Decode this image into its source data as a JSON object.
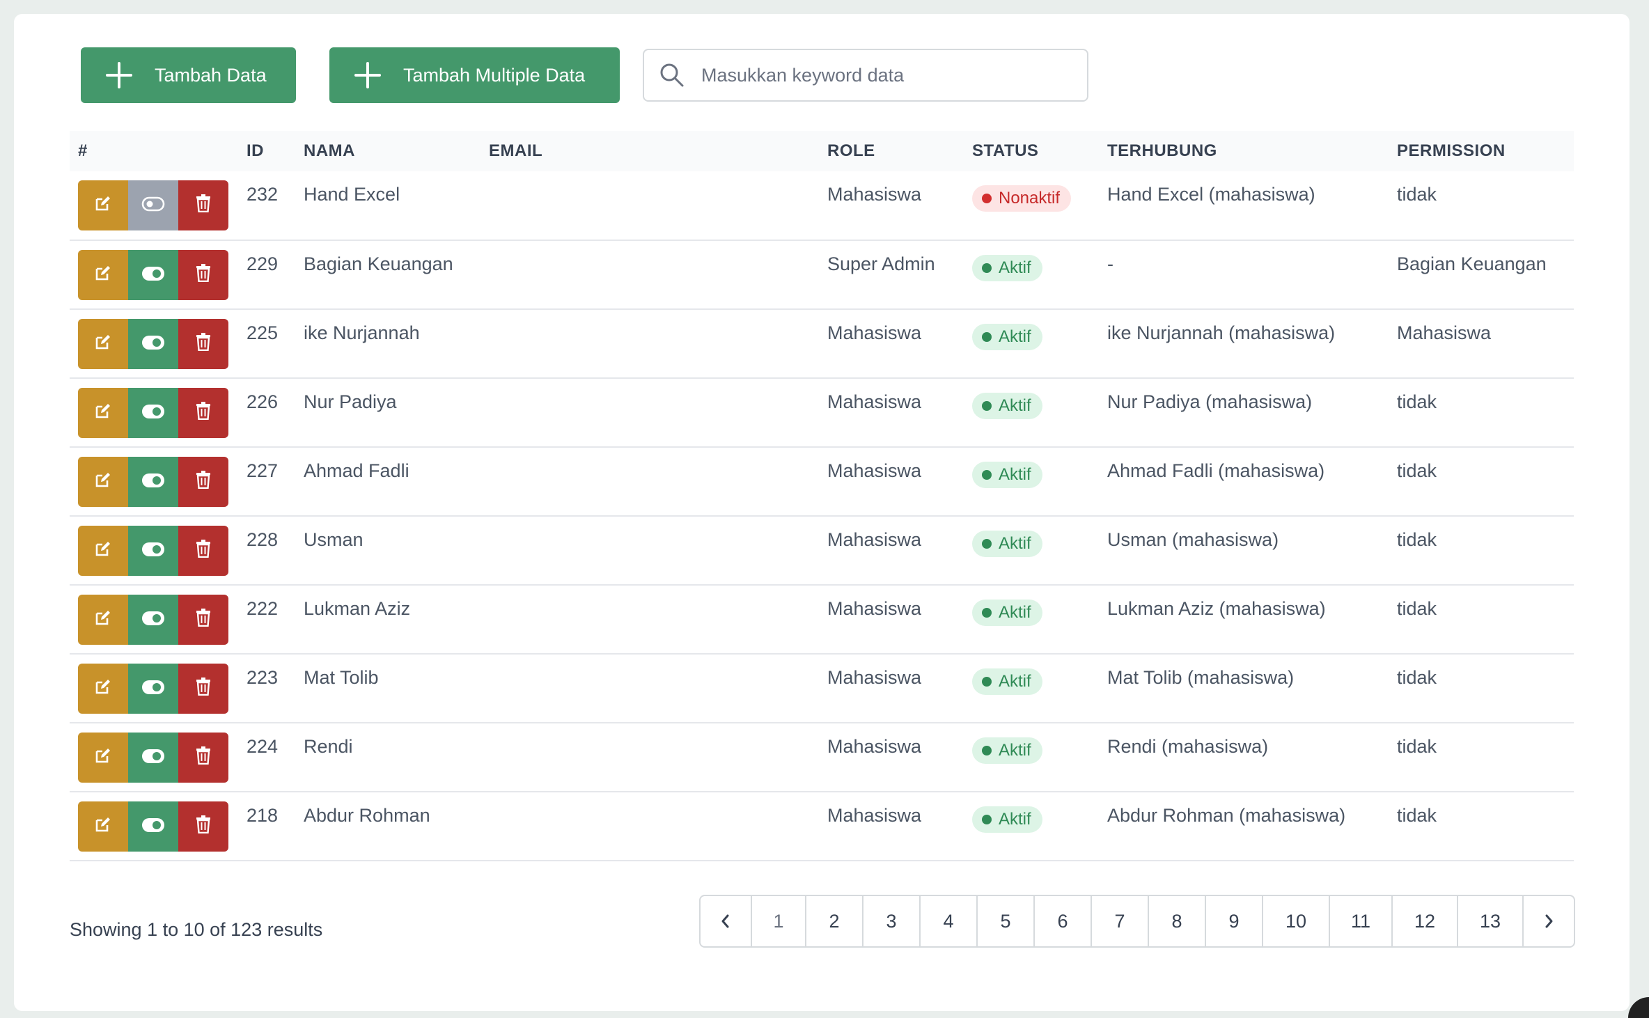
{
  "toolbar": {
    "add_label": "Tambah Data",
    "add_multiple_label": "Tambah Multiple Data",
    "search_placeholder": "Masukkan keyword data",
    "search_value": ""
  },
  "table": {
    "headers": [
      "#",
      "ID",
      "NAMA",
      "EMAIL",
      "ROLE",
      "STATUS",
      "TERHUBUNG",
      "PERMISSION"
    ],
    "rows": [
      {
        "id": "232",
        "nama": "Hand Excel",
        "email": "",
        "role": "Mahasiswa",
        "status": "Nonaktif",
        "active": false,
        "terhubung": "Hand Excel (mahasiswa)",
        "permission": "tidak"
      },
      {
        "id": "229",
        "nama": "Bagian Keuangan",
        "email": "",
        "role": "Super Admin",
        "status": "Aktif",
        "active": true,
        "terhubung": "-",
        "permission": "Bagian Keuangan"
      },
      {
        "id": "225",
        "nama": "ike Nurjannah",
        "email": "",
        "role": "Mahasiswa",
        "status": "Aktif",
        "active": true,
        "terhubung": "ike Nurjannah (mahasiswa)",
        "permission": "Mahasiswa"
      },
      {
        "id": "226",
        "nama": "Nur Padiya",
        "email": "",
        "role": "Mahasiswa",
        "status": "Aktif",
        "active": true,
        "terhubung": "Nur Padiya (mahasiswa)",
        "permission": "tidak"
      },
      {
        "id": "227",
        "nama": "Ahmad Fadli",
        "email": "",
        "role": "Mahasiswa",
        "status": "Aktif",
        "active": true,
        "terhubung": "Ahmad Fadli (mahasiswa)",
        "permission": "tidak"
      },
      {
        "id": "228",
        "nama": "Usman",
        "email": "",
        "role": "Mahasiswa",
        "status": "Aktif",
        "active": true,
        "terhubung": "Usman (mahasiswa)",
        "permission": "tidak"
      },
      {
        "id": "222",
        "nama": "Lukman Aziz",
        "email": "",
        "role": "Mahasiswa",
        "status": "Aktif",
        "active": true,
        "terhubung": "Lukman Aziz (mahasiswa)",
        "permission": "tidak"
      },
      {
        "id": "223",
        "nama": "Mat Tolib",
        "email": "",
        "role": "Mahasiswa",
        "status": "Aktif",
        "active": true,
        "terhubung": "Mat Tolib (mahasiswa)",
        "permission": "tidak"
      },
      {
        "id": "224",
        "nama": "Rendi",
        "email": "",
        "role": "Mahasiswa",
        "status": "Aktif",
        "active": true,
        "terhubung": "Rendi (mahasiswa)",
        "permission": "tidak"
      },
      {
        "id": "218",
        "nama": "Abdur Rohman",
        "email": "",
        "role": "Mahasiswa",
        "status": "Aktif",
        "active": true,
        "terhubung": "Abdur Rohman (mahasiswa)",
        "permission": "tidak"
      }
    ],
    "row_action_icons": [
      "edit-icon",
      "toggle-icon",
      "trash-icon"
    ]
  },
  "footer": {
    "showing_text": "Showing 1 to 10 of 123 results",
    "pages": [
      "1",
      "2",
      "3",
      "4",
      "5",
      "6",
      "7",
      "8",
      "9",
      "10",
      "11",
      "12",
      "13"
    ],
    "current_page": "1"
  },
  "colors": {
    "primary_green": "#44986b",
    "edit_yellow": "#c8922a",
    "delete_red": "#b3302e",
    "inactive_gray": "#9ca3af",
    "aktif_badge_bg": "#ddf4e6",
    "nonaktif_badge_bg": "#fde4e4"
  }
}
